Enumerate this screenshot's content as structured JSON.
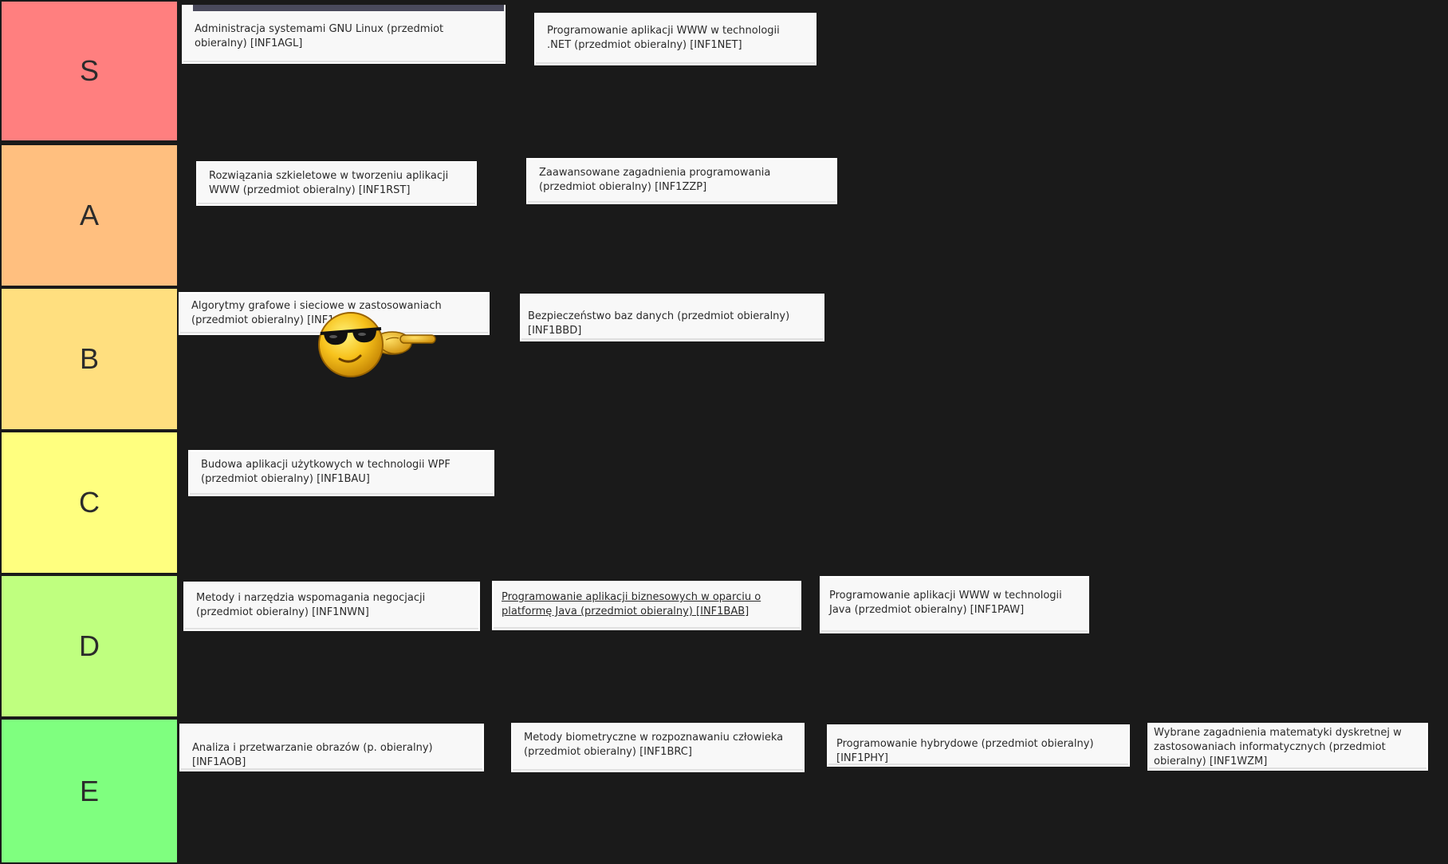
{
  "tiers": [
    {
      "label": "S",
      "color": "#ff7f7f",
      "items": [
        "Administracja systemami GNU Linux (przedmiot obieralny) [INF1AGL]",
        "Programowanie aplikacji WWW w technologii .NET (przedmiot obieralny) [INF1NET]"
      ]
    },
    {
      "label": "A",
      "color": "#ffbf7f",
      "items": [
        "Rozwiązania szkieletowe w tworzeniu aplikacji WWW (przedmiot obieralny) [INF1RST]",
        "Zaawansowane zagadnienia programowania (przedmiot obieralny) [INF1ZZP]"
      ]
    },
    {
      "label": "B",
      "color": "#ffdf7f",
      "items": [
        "Algorytmy grafowe i sieciowe w zastosowaniach (przedmiot obieralny) [INF1AGS]",
        "Bezpieczeństwo baz danych (przedmiot obieralny) [INF1BBD]"
      ]
    },
    {
      "label": "C",
      "color": "#ffff7f",
      "items": [
        "Budowa aplikacji użytkowych w technologii WPF (przedmiot obieralny) [INF1BAU]"
      ]
    },
    {
      "label": "D",
      "color": "#bfff7f",
      "items": [
        "Metody i narzędzia wspomagania negocjacji (przedmiot obieralny) [INF1NWN]",
        "Programowanie aplikacji biznesowych w oparciu o platformę Java (przedmiot obieralny) [INF1BAB]",
        "Programowanie aplikacji WWW w technologii Java (przedmiot obieralny) [INF1PAW]"
      ]
    },
    {
      "label": "E",
      "color": "#7fff7f",
      "items": [
        "Analiza i przetwarzanie obrazów (p. obieralny) [INF1AOB]",
        "Metody biometryczne w rozpoznawaniu człowieka (przedmiot obieralny) [INF1BRC]",
        "Programowanie hybrydowe (przedmiot obieralny) [INF1PHY]",
        "Wybrane zagadnienia matematyki dyskretnej w zastosowaniach informatycznych (przedmiot obieralny) [INF1WZM]"
      ]
    }
  ],
  "decoration": {
    "sticker": "cool-sunglasses-smiley-pointing-icon"
  }
}
